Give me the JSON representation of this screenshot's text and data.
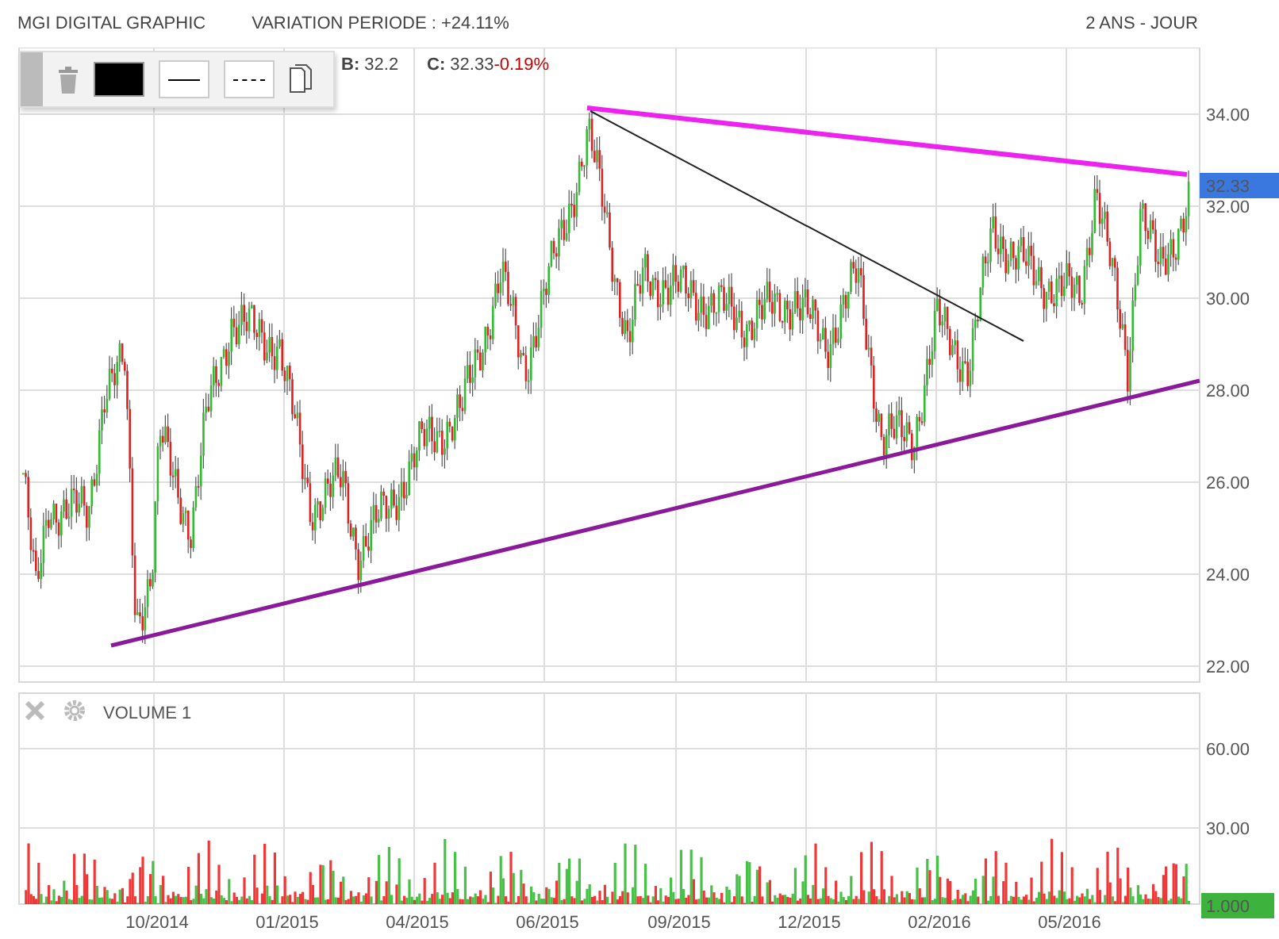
{
  "header": {
    "title": "MGI DIGITAL GRAPHIC",
    "variation": "VARIATION PERIODE : +24.11%",
    "period": "2 ANS - JOUR"
  },
  "readings": [
    {
      "label": "B:",
      "value": "32.2"
    },
    {
      "label": "C:",
      "value": "32.33",
      "change": "-0.19%"
    }
  ],
  "price_axis": {
    "ticks": [
      "34.00",
      "32.00",
      "30.00",
      "28.00",
      "26.00",
      "24.00",
      "22.00"
    ],
    "last_price": "32.33"
  },
  "volume_panel": {
    "title": "VOLUME 1",
    "ticks": [
      "60.00",
      "30.00"
    ],
    "last_volume": "1.000"
  },
  "x_axis": {
    "labels": [
      "10/2014",
      "01/2015",
      "04/2015",
      "06/2015",
      "09/2015",
      "12/2015",
      "02/2016",
      "05/2016"
    ]
  }
}
